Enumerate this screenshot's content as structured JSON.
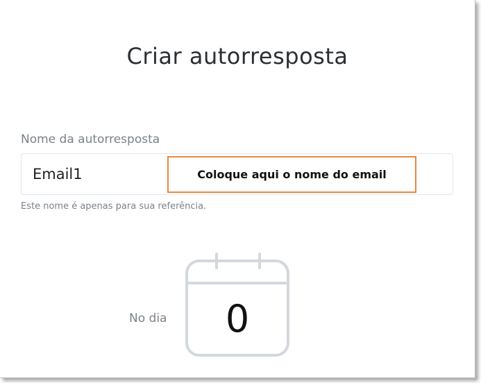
{
  "header": {
    "title": "Criar autorresposta"
  },
  "name_field": {
    "label": "Nome da autorresposta",
    "value": "Email1",
    "helper": "Este nome é apenas para sua referência."
  },
  "callout": {
    "text": "Coloque aqui o nome do email",
    "border_color": "#e8873f"
  },
  "schedule": {
    "day_label": "No dia",
    "day_value": "0",
    "icon": "calendar-icon",
    "icon_color": "#d3d8de"
  }
}
